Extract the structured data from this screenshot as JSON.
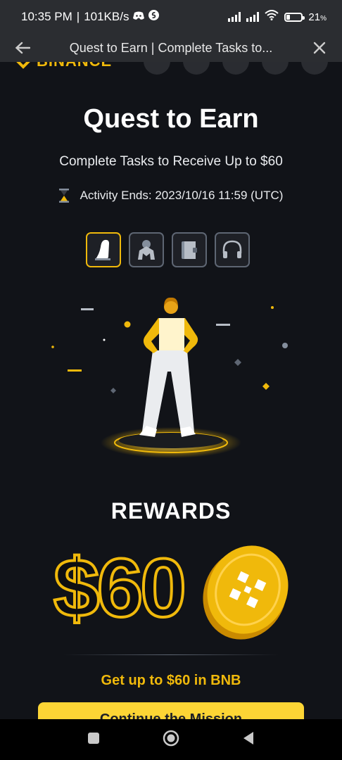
{
  "status_bar": {
    "time": "10:35 PM",
    "network_speed": "101KB/s",
    "battery": "21"
  },
  "app_bar": {
    "title": "Quest to Earn | Complete Tasks to..."
  },
  "brand": {
    "name": "BINANCE"
  },
  "hero": {
    "title": "Quest to Earn",
    "subtitle": "Complete Tasks to Receive Up to $60",
    "activity_ends_label": "Activity Ends: 2023/10/16 11:59 (UTC)"
  },
  "category_tabs": [
    {
      "icon": "ski-slope-icon",
      "active": true
    },
    {
      "icon": "robot-claw-icon",
      "active": false
    },
    {
      "icon": "book-icon",
      "active": false
    },
    {
      "icon": "headphones-icon",
      "active": false
    }
  ],
  "rewards": {
    "heading": "REWARDS",
    "amount": "$60",
    "coin_icon": "bnb-coin-icon",
    "caption": "Get up to $60 in BNB",
    "button_label": "Continue the Mission"
  },
  "colors": {
    "accent": "#f0b90b",
    "button": "#fcd535",
    "background": "#111318"
  }
}
